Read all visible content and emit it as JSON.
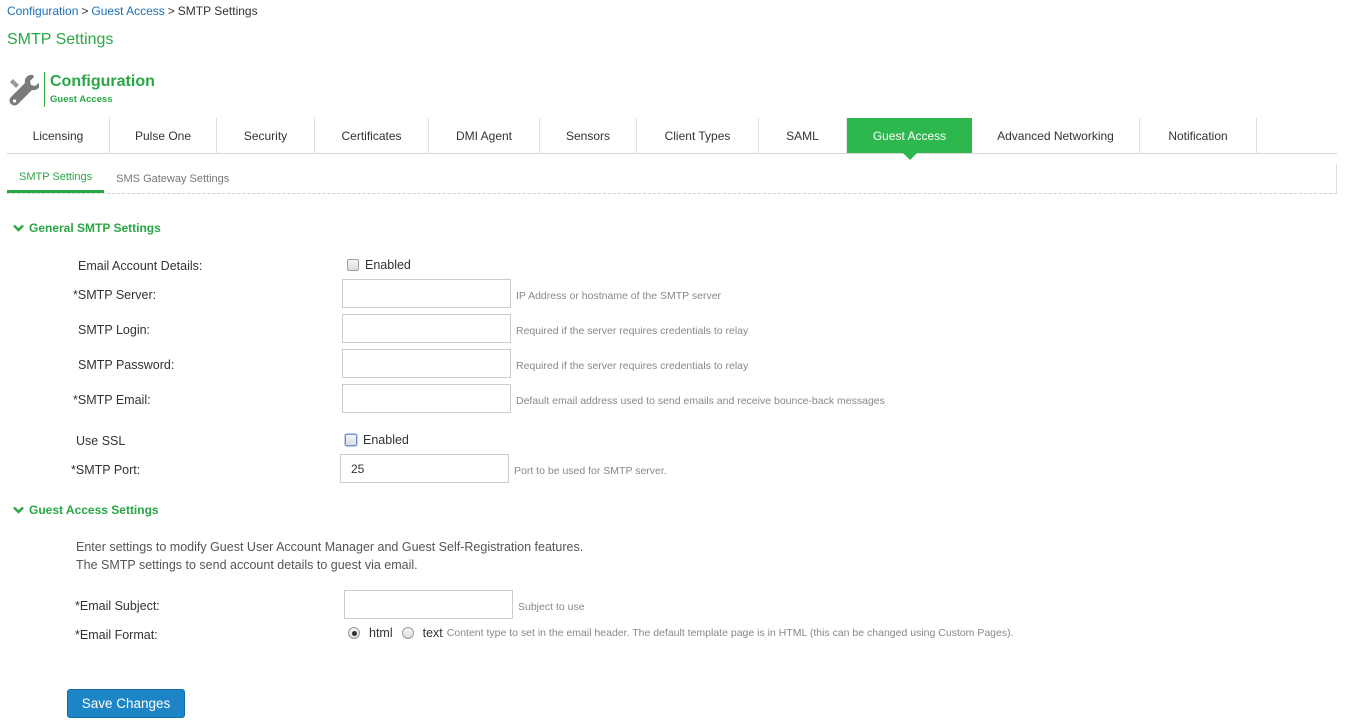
{
  "breadcrumb": {
    "items": [
      "Configuration",
      "Guest Access",
      "SMTP Settings"
    ],
    "separator": ">"
  },
  "page_title": "SMTP Settings",
  "header": {
    "icon": "wrench-icon",
    "title": "Configuration",
    "subtitle": "Guest Access"
  },
  "main_tabs": [
    {
      "label": "Licensing"
    },
    {
      "label": "Pulse One"
    },
    {
      "label": "Security"
    },
    {
      "label": "Certificates"
    },
    {
      "label": "DMI Agent"
    },
    {
      "label": "Sensors"
    },
    {
      "label": "Client Types"
    },
    {
      "label": "SAML"
    },
    {
      "label": "Guest Access",
      "active": true
    },
    {
      "label": "Advanced Networking"
    },
    {
      "label": "Notification"
    }
  ],
  "sub_tabs": [
    {
      "label": "SMTP Settings",
      "active": true
    },
    {
      "label": "SMS Gateway Settings"
    }
  ],
  "general": {
    "title": "General SMTP Settings",
    "email_account": {
      "label": "Email Account Details:",
      "checkbox_label": "Enabled",
      "checked": false
    },
    "smtp_server": {
      "label": "*SMTP Server:",
      "value": "",
      "hint": "IP Address or hostname of the SMTP server"
    },
    "smtp_login": {
      "label": "SMTP Login:",
      "value": "",
      "hint": "Required if the server requires credentials to relay"
    },
    "smtp_password": {
      "label": "SMTP Password:",
      "value": "",
      "hint": "Required if the server requires credentials to relay"
    },
    "smtp_email": {
      "label": "*SMTP Email:",
      "value": "",
      "hint": "Default email address used to send emails and receive bounce-back messages"
    },
    "use_ssl": {
      "label": "Use SSL",
      "checkbox_label": "Enabled",
      "checked": false
    },
    "smtp_port": {
      "label": "*SMTP Port:",
      "value": "25",
      "hint": "Port to be used for SMTP server."
    }
  },
  "guest": {
    "title": "Guest Access Settings",
    "description_line1": "Enter settings to modify Guest User Account Manager and Guest Self-Registration features.",
    "description_line2": "The SMTP settings to send account details to guest via email.",
    "email_subject": {
      "label": "*Email Subject:",
      "value": "",
      "hint": "Subject to use"
    },
    "email_format": {
      "label": "*Email Format:",
      "options": [
        "html",
        "text"
      ],
      "selected": "html",
      "hint": "Content type to set in the email header. The default template page is in HTML (this can be changed using Custom Pages)."
    }
  },
  "save_button": "Save Changes",
  "colors": {
    "accent_green": "#2db84d",
    "link_blue": "#1a6fb5",
    "button_blue": "#1d84c6"
  }
}
